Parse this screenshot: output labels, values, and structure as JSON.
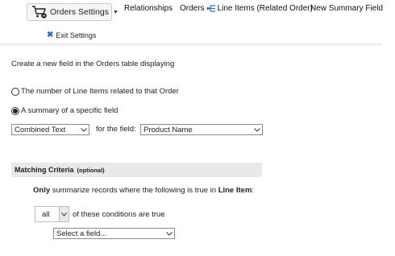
{
  "toolbar": {
    "settings_button": {
      "label": "Orders Settings",
      "icon": "cart-gear-icon"
    },
    "exit_settings": {
      "icon": "close-icon",
      "label": "Exit Settings"
    },
    "nav": {
      "relationships": "Relationships",
      "orders_prefix": "Orders",
      "relation_icon": "relationship-icon",
      "orders_suffix": "Line Items (Related Order)",
      "new_summary_field": "New Summary Field"
    }
  },
  "form": {
    "intro": "Create a new field in the Orders table displaying",
    "options": [
      {
        "label": "The number of Line Items related to that Order",
        "selected": false
      },
      {
        "label": "A summary of a specific field",
        "selected": true
      }
    ],
    "summary_type_select": {
      "value": "Combined Text"
    },
    "for_the_field_label": "for the field:",
    "field_select": {
      "value": "Product Name"
    }
  },
  "criteria": {
    "title": "Matching Criteria",
    "optional": "(optional)",
    "only_bold": "Only",
    "only_mid": "summarize records where the following is true in",
    "only_table": "Line Item",
    "only_colon": ":",
    "match_select": {
      "value": "all"
    },
    "conditions_text": "of these conditions are true",
    "field_select": {
      "value": "Select a field..."
    }
  },
  "colors": {
    "accent_blue": "#2a6ec6",
    "criteria_bar": "#e9e9e9"
  }
}
